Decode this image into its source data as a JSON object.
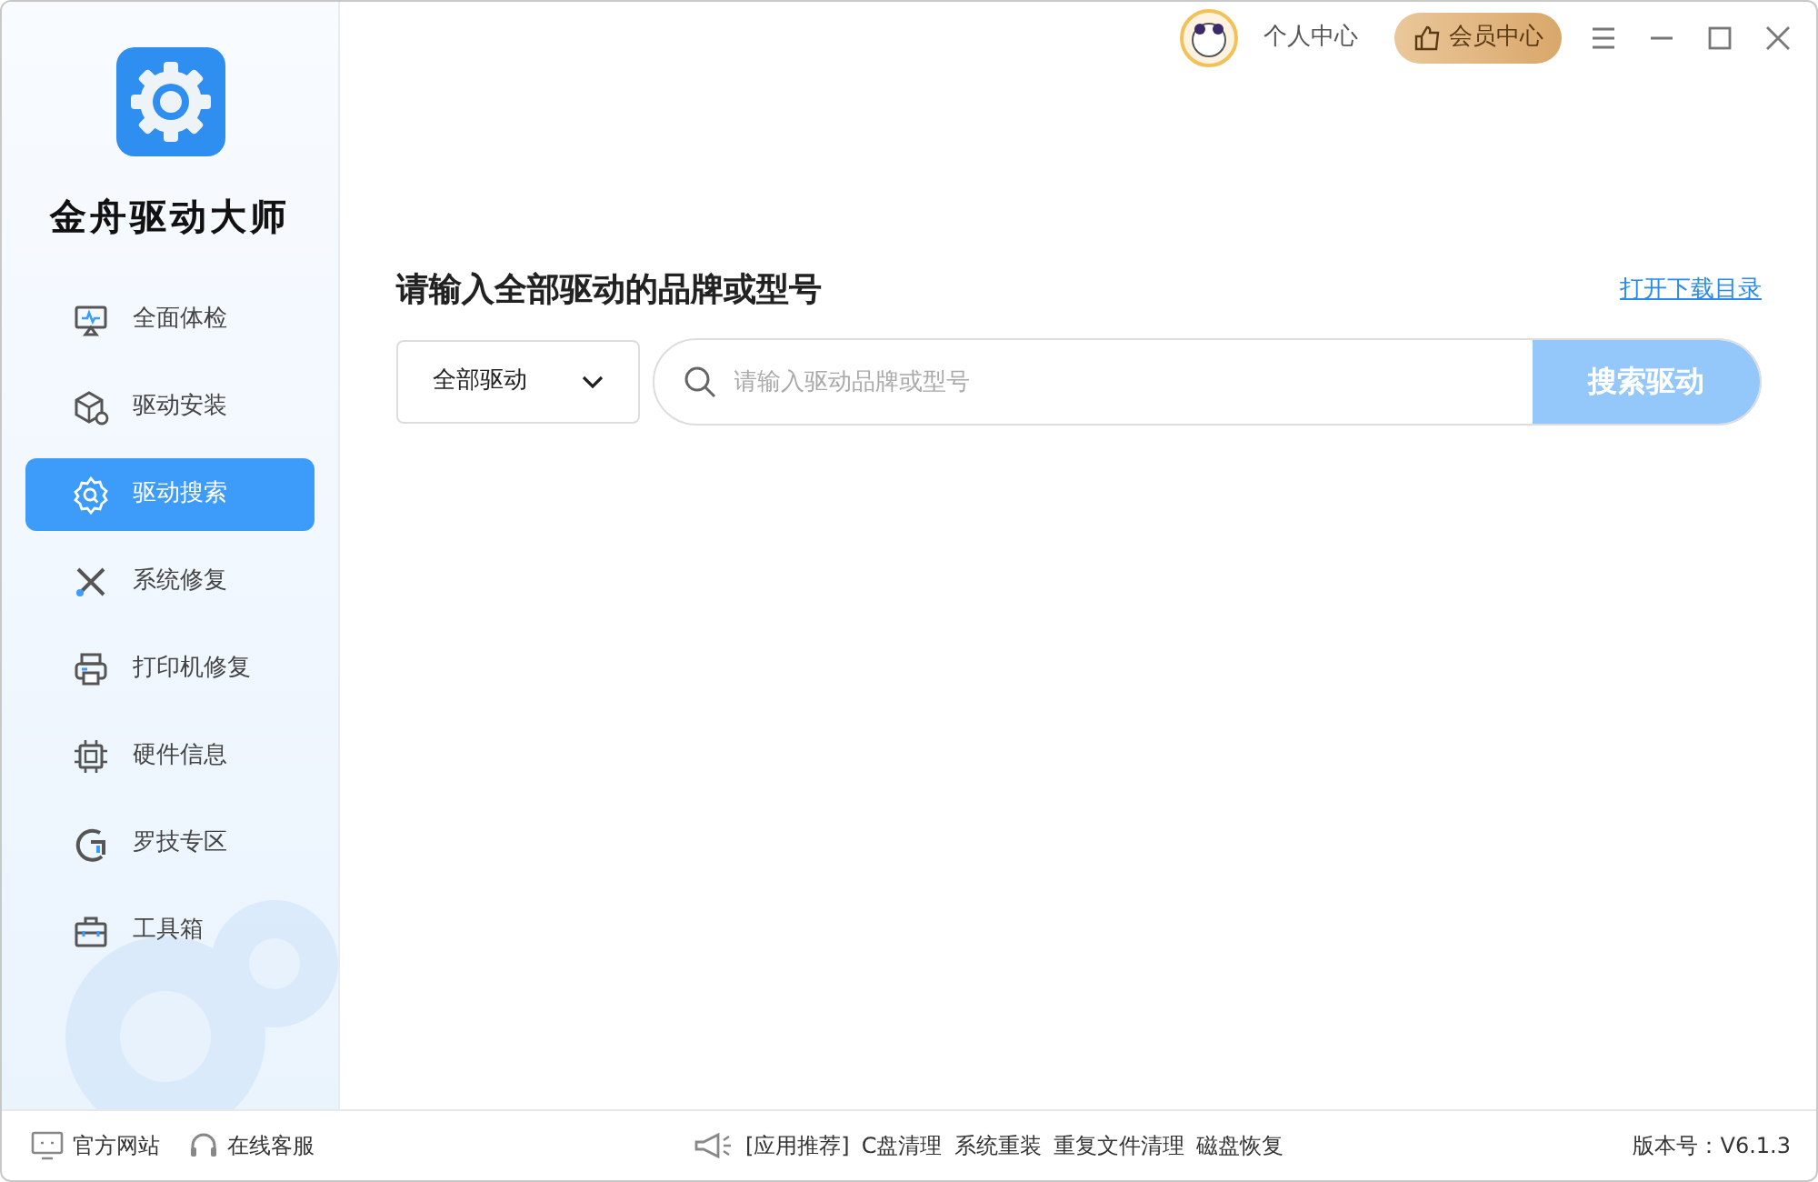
{
  "app": {
    "name": "金舟驱动大师"
  },
  "sidebar": {
    "items": [
      {
        "label": "全面体检",
        "selected": false
      },
      {
        "label": "驱动安装",
        "selected": false
      },
      {
        "label": "驱动搜索",
        "selected": true
      },
      {
        "label": "系统修复",
        "selected": false
      },
      {
        "label": "打印机修复",
        "selected": false
      },
      {
        "label": "硬件信息",
        "selected": false
      },
      {
        "label": "罗技专区",
        "selected": false
      },
      {
        "label": "工具箱",
        "selected": false
      }
    ]
  },
  "header": {
    "user": "个人中心",
    "vip": "会员中心"
  },
  "search": {
    "title": "请输入全部驱动的品牌或型号",
    "link": "打开下载目录",
    "category": "全部驱动",
    "placeholder": "请输入驱动品牌或型号",
    "button": "搜索驱动",
    "disabled": true
  },
  "status_bar": {
    "left": [
      "官方网站",
      "在线客服"
    ],
    "promo_label": "[应用推荐]",
    "promos": [
      "C盘清理",
      "系统重装",
      "重复文件清理",
      "磁盘恢复"
    ],
    "version": "版本号：V6.1.3"
  }
}
